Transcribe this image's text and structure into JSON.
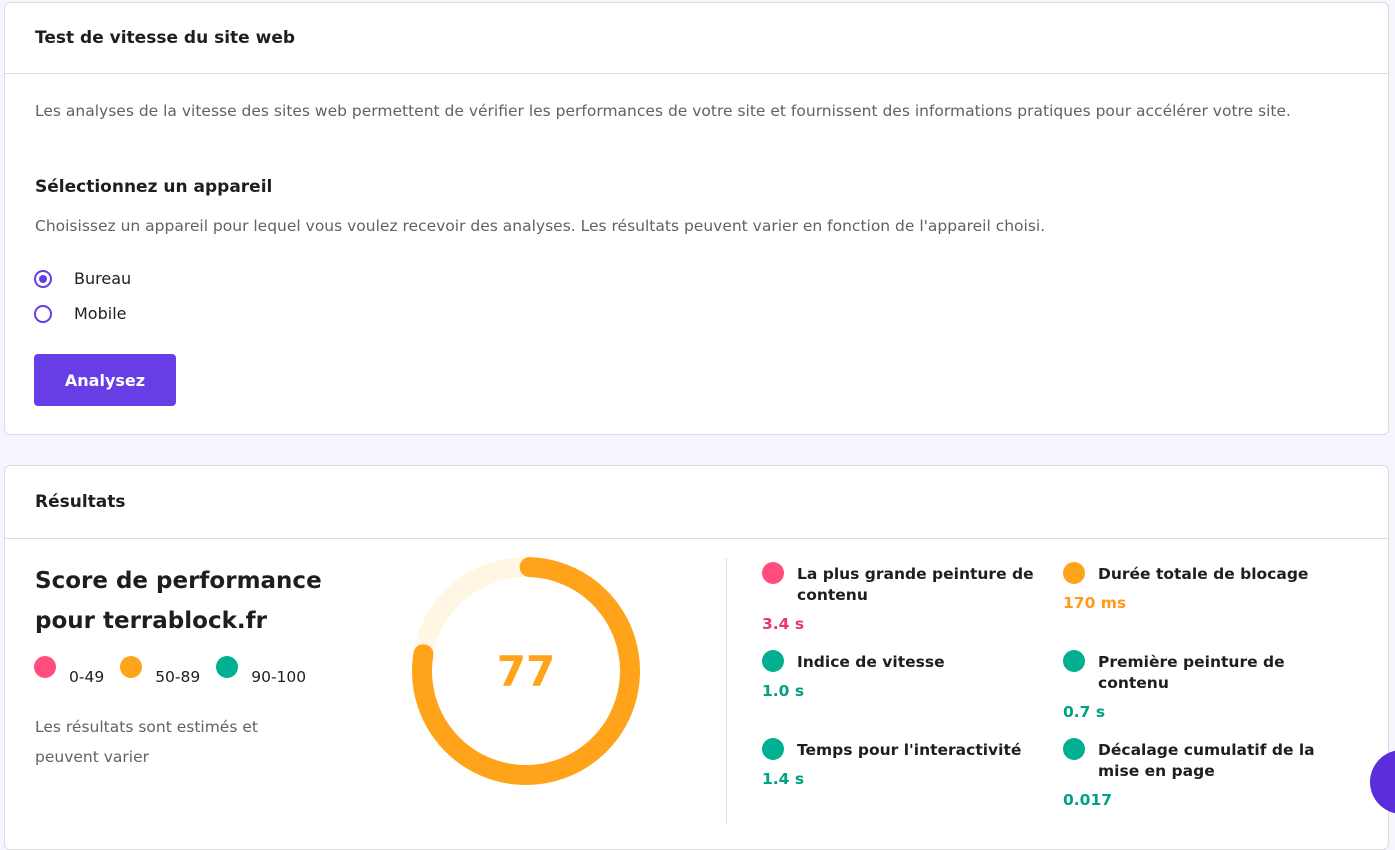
{
  "speed_test": {
    "title": "Test de vitesse du site web",
    "description": "Les analyses de la vitesse des sites web permettent de vérifier les performances de votre site et fournissent des informations pratiques pour accélérer votre site.",
    "device_title": "Sélectionnez un appareil",
    "device_description": "Choisissez un appareil pour lequel vous voulez recevoir des analyses. Les résultats peuvent varier en fonction de l'appareil choisi.",
    "devices": [
      {
        "label": "Bureau",
        "selected": true
      },
      {
        "label": "Mobile",
        "selected": false
      }
    ],
    "analyse_button": "Analysez"
  },
  "results": {
    "title": "Résultats",
    "score_title": "Score de performance pour terrablock.fr",
    "legend": [
      {
        "label": "0-49",
        "color": "#ff4d7e"
      },
      {
        "label": "50-89",
        "color": "#ffa41a"
      },
      {
        "label": "90-100",
        "color": "#00b090"
      }
    ],
    "estimate_note": "Les résultats sont estimés et peuvent varier",
    "score": "77",
    "score_fraction": 0.77,
    "score_color": "#ffa41a",
    "score_track_color": "#fff6e3",
    "metrics": [
      {
        "name": "La plus grande peinture de contenu",
        "value": "3.4 s",
        "color": "#ff4d7e",
        "value_color": "#e5396a"
      },
      {
        "name": "Durée totale de blocage",
        "value": "170 ms",
        "color": "#ffa41a",
        "value_color": "#ff9a1a"
      },
      {
        "name": "Indice de vitesse",
        "value": "1.0 s",
        "color": "#00b090",
        "value_color": "#00a284"
      },
      {
        "name": "Première peinture de contenu",
        "value": "0.7 s",
        "color": "#00b090",
        "value_color": "#00a284"
      },
      {
        "name": "Temps pour l'interactivité",
        "value": "1.4 s",
        "color": "#00b090",
        "value_color": "#00a284"
      },
      {
        "name": "Décalage cumulatif de la mise en page",
        "value": "0.017",
        "color": "#00b090",
        "value_color": "#00a284"
      }
    ]
  },
  "theme": {
    "accent": "#673de6"
  }
}
